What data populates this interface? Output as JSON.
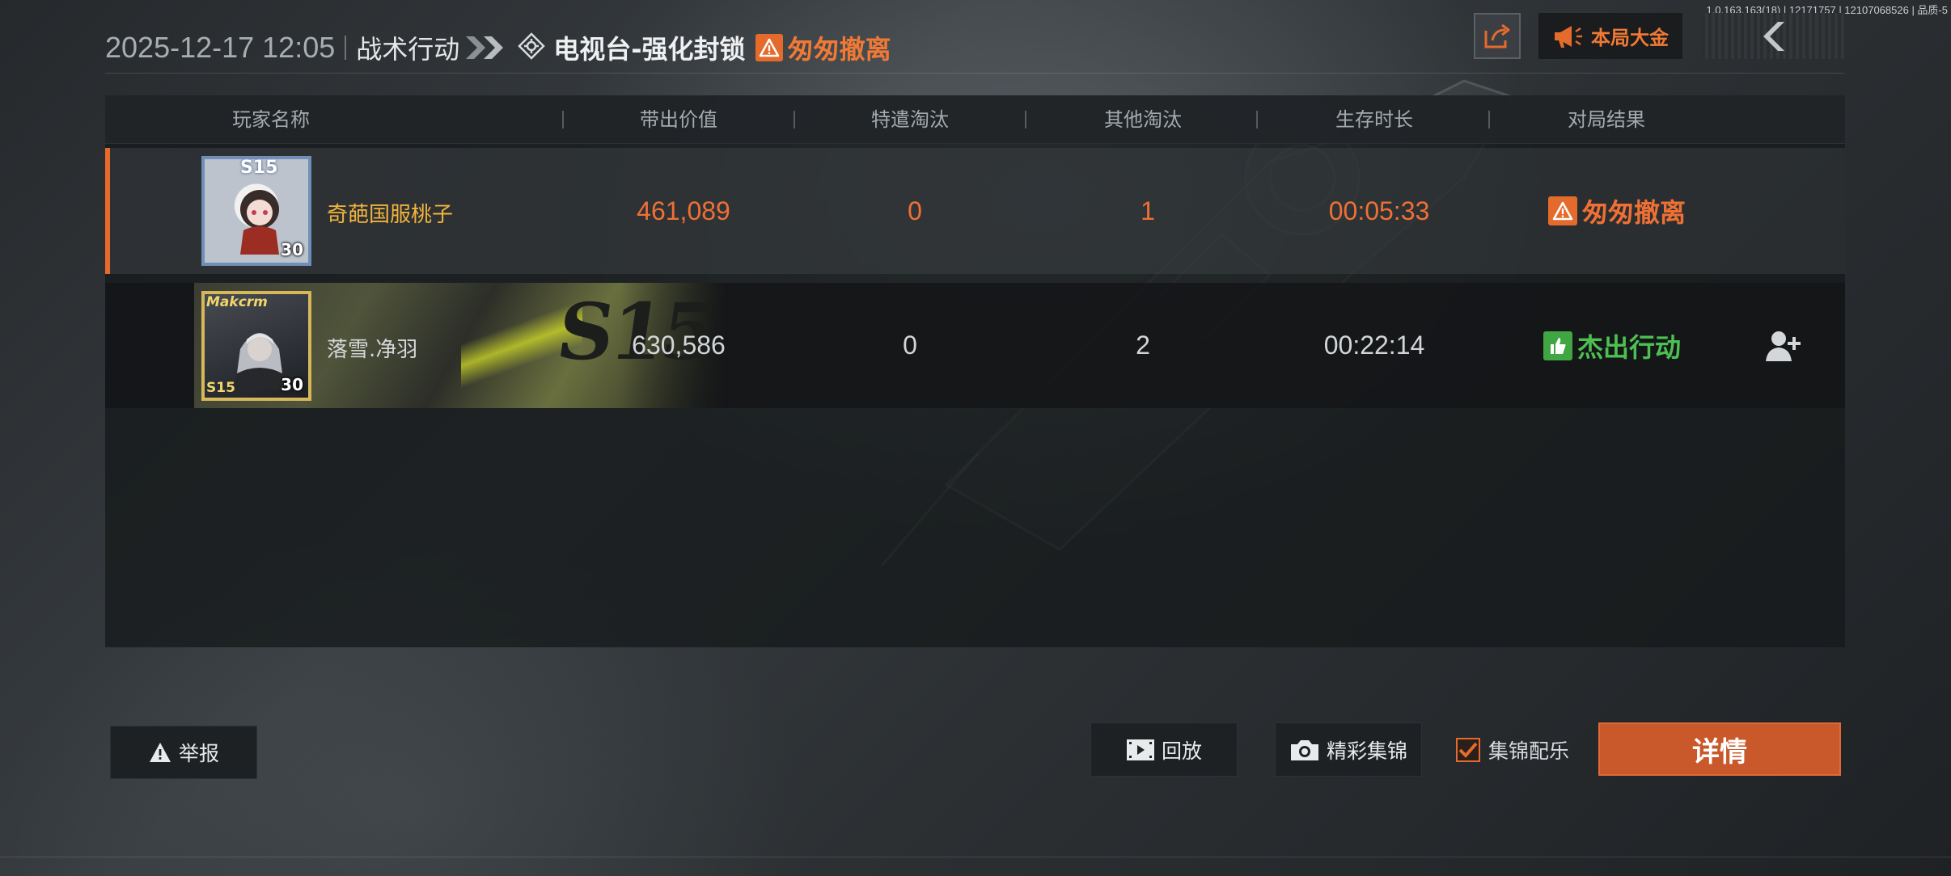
{
  "version_info": "1.0.163.163(18) | 12171757 | 12107068526 | 品质-5",
  "header": {
    "datetime": "2025-12-17 12:05",
    "mode": "战术行动",
    "map": "电视台-强化封锁",
    "status": "匆匆撤离"
  },
  "top_buttons": {
    "pot_label": "本局大金"
  },
  "table": {
    "columns": [
      "玩家名称",
      "带出价值",
      "特遣淘汰",
      "其他淘汰",
      "生存时长",
      "对局结果"
    ],
    "rows": [
      {
        "player_name": "奇葩国服桃子",
        "level": "30",
        "season_badge": "S15",
        "extracted_value": "461,089",
        "operator_kills": "0",
        "other_kills": "1",
        "survival_time": "00:05:33",
        "result": "匆匆撤离",
        "result_color": "#ef7035"
      },
      {
        "player_name": "落雪.净羽",
        "level": "30",
        "season_badge": "S15",
        "avatar_tag": "Makcrm",
        "banner_text": "S15",
        "extracted_value": "630,586",
        "operator_kills": "0",
        "other_kills": "2",
        "survival_time": "00:22:14",
        "result": "杰出行动",
        "result_color": "#4cc151"
      }
    ]
  },
  "bottom": {
    "report_label": "举报",
    "replay_label": "回放",
    "highlights_label": "精彩集锦",
    "music_label": "集锦配乐",
    "music_checked": true,
    "details_label": "详情"
  },
  "colors": {
    "accent_orange": "#e46b2c",
    "success_green": "#3fa642",
    "player_name_gold": "#f3b33c"
  },
  "icons": {
    "share": "share-icon",
    "megaphone": "megaphone-icon",
    "back": "chevron-left-icon",
    "warning": "warning-icon",
    "map": "diamond-crosshair-icon",
    "add_friend": "add-friend-icon",
    "replay": "film-icon",
    "highlights": "camera-icon"
  }
}
